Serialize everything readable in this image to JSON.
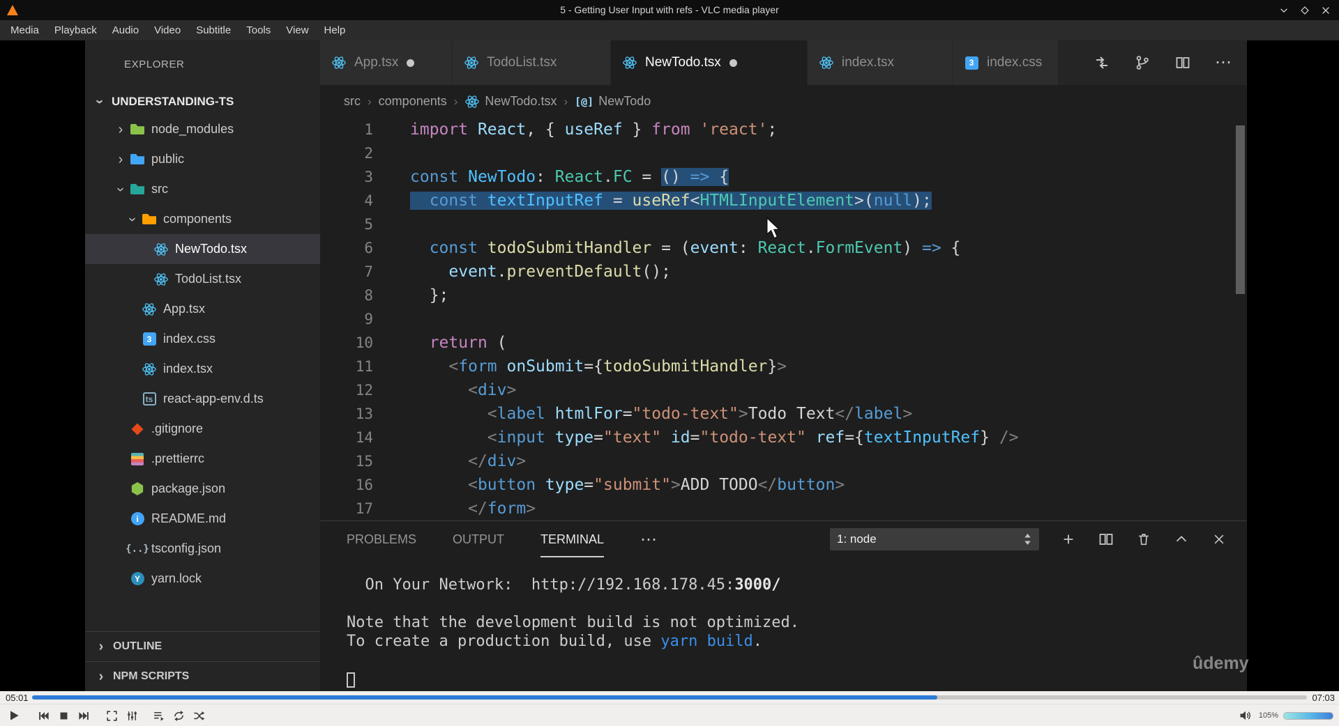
{
  "vlc": {
    "title": "5 - Getting User Input with refs - VLC media player",
    "menu": [
      "Media",
      "Playback",
      "Audio",
      "Video",
      "Subtitle",
      "Tools",
      "View",
      "Help"
    ],
    "window_buttons": [
      {
        "name": "minimize-button",
        "icon": "chevdown"
      },
      {
        "name": "maximize-button",
        "icon": "diamond"
      },
      {
        "name": "close-button",
        "icon": "close"
      }
    ],
    "time_elapsed": "05:01",
    "time_total": "07:03",
    "progress_pct": 71,
    "volume_label": "105%",
    "controls": [
      {
        "name": "play-button",
        "icon": "play"
      },
      {
        "name": "previous-button",
        "icon": "prev"
      },
      {
        "name": "stop-button",
        "icon": "stop"
      },
      {
        "name": "next-button",
        "icon": "next"
      },
      {
        "name": "fullscreen-button",
        "icon": "fullscreen"
      },
      {
        "name": "extended-settings-button",
        "icon": "equalizer"
      },
      {
        "name": "playlist-button",
        "icon": "playlist"
      },
      {
        "name": "loop-button",
        "icon": "loop"
      },
      {
        "name": "random-button",
        "icon": "shuffle"
      }
    ]
  },
  "vscode": {
    "watermark": "ûdemy",
    "explorer": {
      "header": "EXPLORER",
      "project": "UNDERSTANDING-TS",
      "sections": [
        "OUTLINE",
        "NPM SCRIPTS"
      ],
      "tree": [
        {
          "label": "node_modules",
          "level": 1,
          "icon": "folder",
          "color": "#8bc34a",
          "chevron": "closed"
        },
        {
          "label": "public",
          "level": 1,
          "icon": "folder",
          "color": "#42a5f5",
          "chevron": "closed"
        },
        {
          "label": "src",
          "level": 1,
          "icon": "folder",
          "color": "#26a69a",
          "chevron": "open"
        },
        {
          "label": "components",
          "level": 2,
          "icon": "folder",
          "color": "#ffa000",
          "chevron": "open"
        },
        {
          "label": "NewTodo.tsx",
          "level": 3,
          "icon": "react",
          "selected": true
        },
        {
          "label": "TodoList.tsx",
          "level": 3,
          "icon": "react"
        },
        {
          "label": "App.tsx",
          "level": 2,
          "icon": "react"
        },
        {
          "label": "index.css",
          "level": 2,
          "icon": "css"
        },
        {
          "label": "index.tsx",
          "level": 2,
          "icon": "react"
        },
        {
          "label": "react-app-env.d.ts",
          "level": 2,
          "icon": "tsdef"
        },
        {
          "label": ".gitignore",
          "level": 1,
          "icon": "git"
        },
        {
          "label": ".prettierrc",
          "level": 1,
          "icon": "prettier"
        },
        {
          "label": "package.json",
          "level": 1,
          "icon": "node"
        },
        {
          "label": "README.md",
          "level": 1,
          "icon": "info"
        },
        {
          "label": "tsconfig.json",
          "level": 1,
          "icon": "braces"
        },
        {
          "label": "yarn.lock",
          "level": 1,
          "icon": "yarn"
        }
      ]
    },
    "tabs": [
      {
        "label": "App.tsx",
        "icon": "react",
        "modified": true
      },
      {
        "label": "TodoList.tsx",
        "icon": "react"
      },
      {
        "label": "NewTodo.tsx",
        "icon": "react",
        "modified": true,
        "active": true
      },
      {
        "label": "index.tsx",
        "icon": "react"
      },
      {
        "label": "index.css",
        "icon": "css"
      }
    ],
    "tab_actions": [
      {
        "name": "open-changes-icon",
        "icon": "diff"
      },
      {
        "name": "git-branch-icon",
        "icon": "branch"
      },
      {
        "name": "split-editor-icon",
        "icon": "split"
      },
      {
        "name": "more-actions-icon",
        "icon": "more"
      }
    ],
    "breadcrumb": [
      {
        "label": "src"
      },
      {
        "label": "components"
      },
      {
        "label": "NewTodo.tsx",
        "icon": "react"
      },
      {
        "label": "NewTodo",
        "icon": "symbol"
      }
    ],
    "editor": {
      "lines": [
        {
          "n": 1,
          "seg": [
            [
              "pur",
              "import"
            ],
            [
              "df",
              " "
            ],
            [
              "lb",
              "React"
            ],
            [
              "df",
              ", { "
            ],
            [
              "lb",
              "useRef"
            ],
            [
              "df",
              " } "
            ],
            [
              "pur",
              "from"
            ],
            [
              "df",
              " "
            ],
            [
              "or",
              "'react'"
            ],
            [
              "df",
              ";"
            ]
          ]
        },
        {
          "n": 2,
          "seg": []
        },
        {
          "n": 3,
          "seg": [
            [
              "blu",
              "const"
            ],
            [
              "df",
              " "
            ],
            [
              "cb",
              "NewTodo"
            ],
            [
              "df",
              ": "
            ],
            [
              "te",
              "React"
            ],
            [
              "df",
              "."
            ],
            [
              "te",
              "FC"
            ],
            [
              "df",
              " = "
            ],
            [
              "df",
              "()",
              1
            ],
            [
              "df",
              " ",
              1
            ],
            [
              "blu",
              "=>",
              1
            ],
            [
              "df",
              " ",
              1
            ],
            [
              "df",
              "{",
              1
            ]
          ]
        },
        {
          "n": 4,
          "seg": [
            [
              "df",
              "  ",
              1
            ],
            [
              "blu",
              "const",
              1
            ],
            [
              "df",
              " ",
              1
            ],
            [
              "cb",
              "textInputRef",
              1
            ],
            [
              "df",
              " = ",
              1
            ],
            [
              "yel",
              "useRef",
              1
            ],
            [
              "df",
              "<",
              1
            ],
            [
              "te",
              "HTMLInputElement",
              1
            ],
            [
              "df",
              ">(",
              1
            ],
            [
              "blu",
              "null",
              1
            ],
            [
              "df",
              ");",
              1
            ]
          ]
        },
        {
          "n": 5,
          "seg": []
        },
        {
          "n": 6,
          "seg": [
            [
              "df",
              "  "
            ],
            [
              "blu",
              "const"
            ],
            [
              "df",
              " "
            ],
            [
              "yel",
              "todoSubmitHandler"
            ],
            [
              "df",
              " = ("
            ],
            [
              "lb",
              "event"
            ],
            [
              "df",
              ": "
            ],
            [
              "te",
              "React"
            ],
            [
              "df",
              "."
            ],
            [
              "te",
              "FormEvent"
            ],
            [
              "df",
              ") "
            ],
            [
              "blu",
              "=>"
            ],
            [
              "df",
              " {"
            ]
          ]
        },
        {
          "n": 7,
          "seg": [
            [
              "df",
              "    "
            ],
            [
              "lb",
              "event"
            ],
            [
              "df",
              "."
            ],
            [
              "yel",
              "preventDefault"
            ],
            [
              "df",
              "();"
            ]
          ]
        },
        {
          "n": 8,
          "seg": [
            [
              "df",
              "  };"
            ]
          ]
        },
        {
          "n": 9,
          "seg": []
        },
        {
          "n": 10,
          "seg": [
            [
              "df",
              "  "
            ],
            [
              "pur",
              "return"
            ],
            [
              "df",
              " ("
            ]
          ]
        },
        {
          "n": 11,
          "seg": [
            [
              "df",
              "    "
            ],
            [
              "gr",
              "<"
            ],
            [
              "blu",
              "form"
            ],
            [
              "df",
              " "
            ],
            [
              "lb",
              "onSubmit"
            ],
            [
              "df",
              "={"
            ],
            [
              "yel",
              "todoSubmitHandler"
            ],
            [
              "df",
              "}"
            ],
            [
              "gr",
              ">"
            ]
          ]
        },
        {
          "n": 12,
          "seg": [
            [
              "df",
              "      "
            ],
            [
              "gr",
              "<"
            ],
            [
              "blu",
              "div"
            ],
            [
              "gr",
              ">"
            ]
          ]
        },
        {
          "n": 13,
          "seg": [
            [
              "df",
              "        "
            ],
            [
              "gr",
              "<"
            ],
            [
              "blu",
              "label"
            ],
            [
              "df",
              " "
            ],
            [
              "lb",
              "htmlFor"
            ],
            [
              "df",
              "="
            ],
            [
              "or",
              "\"todo-text\""
            ],
            [
              "gr",
              ">"
            ],
            [
              "df",
              "Todo Text"
            ],
            [
              "gr",
              "</"
            ],
            [
              "blu",
              "label"
            ],
            [
              "gr",
              ">"
            ]
          ]
        },
        {
          "n": 14,
          "seg": [
            [
              "df",
              "        "
            ],
            [
              "gr",
              "<"
            ],
            [
              "blu",
              "input"
            ],
            [
              "df",
              " "
            ],
            [
              "lb",
              "type"
            ],
            [
              "df",
              "="
            ],
            [
              "or",
              "\"text\""
            ],
            [
              "df",
              " "
            ],
            [
              "lb",
              "id"
            ],
            [
              "df",
              "="
            ],
            [
              "or",
              "\"todo-text\""
            ],
            [
              "df",
              " "
            ],
            [
              "lb",
              "ref"
            ],
            [
              "df",
              "={"
            ],
            [
              "cb",
              "textInputRef"
            ],
            [
              "df",
              "} "
            ],
            [
              "gr",
              "/>"
            ]
          ]
        },
        {
          "n": 15,
          "seg": [
            [
              "df",
              "      "
            ],
            [
              "gr",
              "</"
            ],
            [
              "blu",
              "div"
            ],
            [
              "gr",
              ">"
            ]
          ]
        },
        {
          "n": 16,
          "seg": [
            [
              "df",
              "      "
            ],
            [
              "gr",
              "<"
            ],
            [
              "blu",
              "button"
            ],
            [
              "df",
              " "
            ],
            [
              "lb",
              "type"
            ],
            [
              "df",
              "="
            ],
            [
              "or",
              "\"submit\""
            ],
            [
              "gr",
              ">"
            ],
            [
              "df",
              "ADD TODO"
            ],
            [
              "gr",
              "</"
            ],
            [
              "blu",
              "button"
            ],
            [
              "gr",
              ">"
            ]
          ]
        },
        {
          "n": 17,
          "seg": [
            [
              "df",
              "      "
            ],
            [
              "gr",
              "</"
            ],
            [
              "blu",
              "form"
            ],
            [
              "gr",
              ">"
            ]
          ]
        }
      ]
    },
    "panel": {
      "tabs": [
        {
          "label": "PROBLEMS"
        },
        {
          "label": "OUTPUT"
        },
        {
          "label": "TERMINAL",
          "active": true
        }
      ],
      "dropdown": "1: node",
      "actions": [
        {
          "name": "new-terminal-button",
          "icon": "plus"
        },
        {
          "name": "split-terminal-button",
          "icon": "split"
        },
        {
          "name": "kill-terminal-button",
          "icon": "trash"
        },
        {
          "name": "maximize-panel-button",
          "icon": "chevup"
        },
        {
          "name": "close-panel-button",
          "icon": "close"
        }
      ],
      "terminal_lines": [
        {
          "seg": [
            {
              "t": "  On Your Network:  "
            },
            {
              "t": "http://192.168.178.45:"
            },
            {
              "t": "3000/",
              "cls": "term-bold"
            }
          ]
        },
        {
          "seg": []
        },
        {
          "seg": [
            {
              "t": "Note that the development build is not optimized."
            }
          ]
        },
        {
          "seg": [
            {
              "t": "To create a production build, use "
            },
            {
              "t": "yarn build",
              "cls": "term-cmd"
            },
            {
              "t": "."
            }
          ]
        },
        {
          "seg": []
        },
        {
          "cursor": true
        }
      ]
    }
  },
  "colors": {
    "selection": "#264f78",
    "seek_progress": "#2e7bd6",
    "terminal_link": "#3b8eea",
    "react_icon": "#4fc3f7"
  }
}
